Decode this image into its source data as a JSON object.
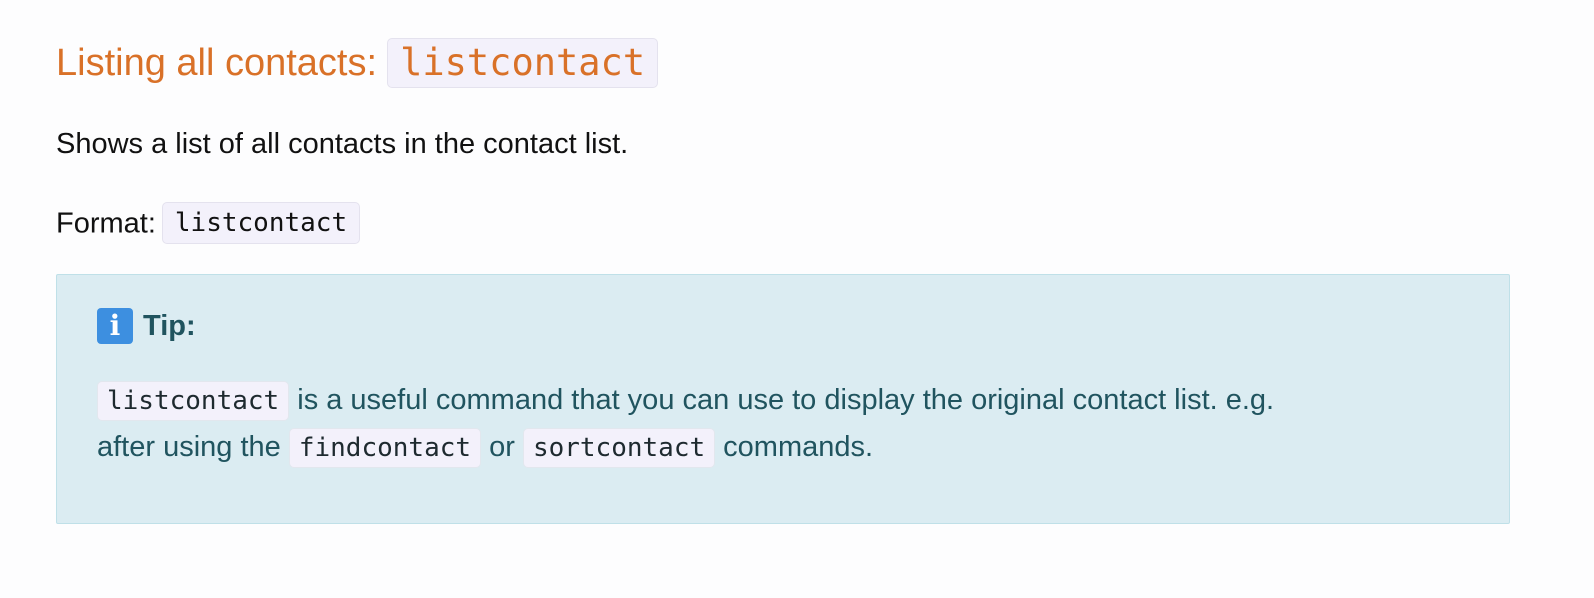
{
  "heading": {
    "text": "Listing all contacts:",
    "code": "listcontact"
  },
  "description": "Shows a list of all contacts in the contact list.",
  "format": {
    "label": "Format:",
    "code": "listcontact"
  },
  "tip": {
    "icon": "info-icon",
    "icon_glyph": "i",
    "title": "Tip:",
    "code_1": "listcontact",
    "text_1": " is a useful command that you can use to display the original contact list. e.g.",
    "text_2": "after using the ",
    "code_2": "findcontact",
    "text_3": " or ",
    "code_3": "sortcontact",
    "text_4": " commands."
  },
  "colors": {
    "heading": "#d97128",
    "tip_background": "#dbecf2",
    "tip_text": "#20545f",
    "code_background": "#f3f1fb",
    "info_icon": "#3d8fe0"
  }
}
